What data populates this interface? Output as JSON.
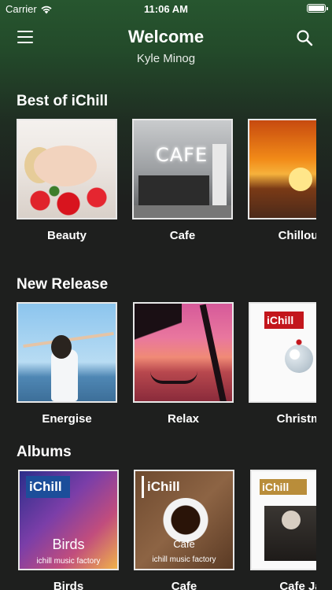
{
  "status_bar": {
    "carrier": "Carrier",
    "time": "11:06 AM"
  },
  "header": {
    "title": "Welcome",
    "subtitle": "Kyle Minog"
  },
  "sections": [
    {
      "title": "Best of iChill",
      "items": [
        {
          "label": "Beauty"
        },
        {
          "label": "Cafe"
        },
        {
          "label": "Chillou"
        }
      ]
    },
    {
      "title": "New Release",
      "items": [
        {
          "label": "Energise"
        },
        {
          "label": "Relax"
        },
        {
          "label": "Christm"
        }
      ]
    },
    {
      "title": "Albums",
      "items": [
        {
          "label": "Birds",
          "art_brand": "iChill",
          "art_title": "Birds",
          "art_sub": "ichill music factory"
        },
        {
          "label": "Cafe",
          "art_brand": "iChill",
          "art_title": "Cafe",
          "art_sub": "ichill music factory"
        },
        {
          "label": "Cafe Ja",
          "art_brand": "iChill"
        }
      ]
    }
  ],
  "new_release_art": {
    "christmas_brand": "iChill"
  },
  "icons": {
    "menu": "hamburger-icon",
    "search": "search-icon",
    "wifi": "wifi-icon",
    "battery": "battery-icon"
  },
  "colors": {
    "header_green": "#27562f",
    "background": "#1e1f1e",
    "text": "#ffffff"
  }
}
